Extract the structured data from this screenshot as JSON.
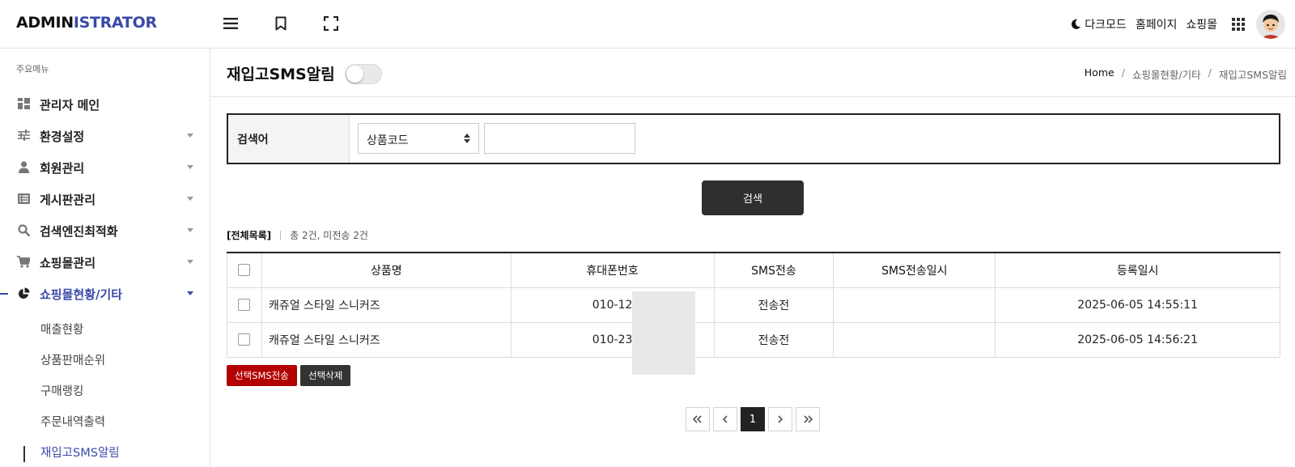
{
  "header": {
    "logo_part1": "ADMIN",
    "logo_part2": "ISTRATOR",
    "dark_mode_label": "다크모드",
    "homepage_label": "홈페이지",
    "shop_label": "쇼핑몰"
  },
  "sidebar": {
    "title": "주요메뉴",
    "items": [
      {
        "label": "관리자 메인"
      },
      {
        "label": "환경설정"
      },
      {
        "label": "회원관리"
      },
      {
        "label": "게시판관리"
      },
      {
        "label": "검색엔진최적화"
      },
      {
        "label": "쇼핑몰관리"
      },
      {
        "label": "쇼핑몰현황/기타"
      }
    ],
    "sub_items": [
      {
        "label": "매출현황"
      },
      {
        "label": "상품판매순위"
      },
      {
        "label": "구매랭킹"
      },
      {
        "label": "주문내역출력"
      },
      {
        "label": "재입고SMS알림"
      }
    ]
  },
  "page": {
    "title": "재입고SMS알림",
    "breadcrumb": [
      "Home",
      "쇼핑몰현황/기타",
      "재입고SMS알림"
    ]
  },
  "search": {
    "label": "검색어",
    "select_value": "상품코드",
    "input_value": "",
    "button_label": "검색"
  },
  "summary": {
    "all_label": "[전체목록]",
    "counts": "총 2건, 미전송 2건"
  },
  "table": {
    "headers": [
      "상품명",
      "휴대폰번호",
      "SMS전송",
      "SMS전송일시",
      "등록일시"
    ],
    "rows": [
      {
        "product": "캐쥬얼 스타일 스니커즈",
        "phone": "010-12",
        "sms_status": "전송전",
        "sms_sent_at": "",
        "registered_at": "2025-06-05 14:55:11"
      },
      {
        "product": "캐쥬얼 스타일 스니커즈",
        "phone": "010-23",
        "sms_status": "전송전",
        "sms_sent_at": "",
        "registered_at": "2025-06-05 14:56:21"
      }
    ]
  },
  "actions": {
    "send_sms_label": "선택SMS전송",
    "delete_label": "선택삭제"
  },
  "pagination": {
    "current_page": "1"
  },
  "colors": {
    "brand": "#3a4aa8",
    "send_button": "#b30000",
    "dark_button": "#2f2f2f"
  },
  "icons": {
    "header": [
      "hamburger-menu-icon",
      "bookmark-icon",
      "fullscreen-icon",
      "moon-icon",
      "apps-grid-icon"
    ],
    "sidebar": [
      "dashboard-icon",
      "sliders-icon",
      "user-icon",
      "list-icon",
      "search-icon",
      "cart-icon",
      "pie-chart-icon"
    ]
  }
}
